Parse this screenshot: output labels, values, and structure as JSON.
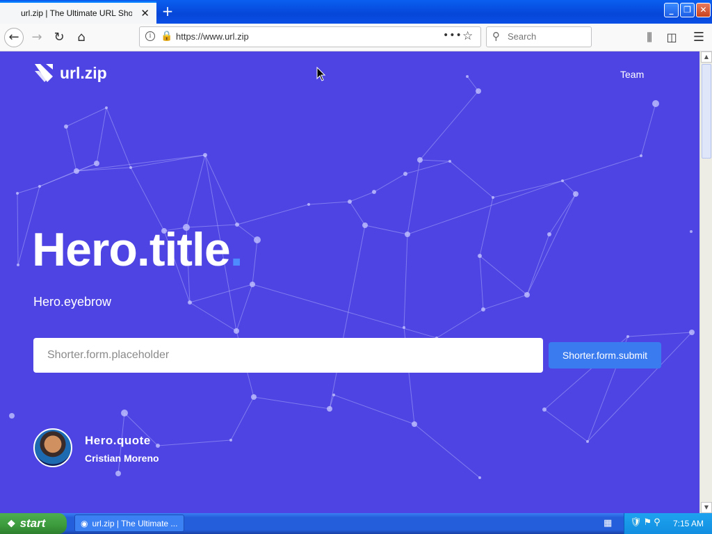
{
  "browser": {
    "tab_title": "url.zip | The Ultimate URL Shorten",
    "new_tab_icon": "+",
    "url": "https://www.url.zip",
    "search_placeholder": "Search"
  },
  "site": {
    "brand": "url.zip",
    "nav": {
      "team": "Team"
    },
    "hero": {
      "title": "Hero.title",
      "title_dot": ".",
      "eyebrow": "Hero.eyebrow",
      "form_placeholder": "Shorter.form.placeholder",
      "submit_label": "Shorter.form.submit",
      "quote": "Hero.quote",
      "author": "Cristian Moreno"
    },
    "colors": {
      "background": "#4e44e3",
      "accent": "#3a7bf0",
      "dot": "#4e8bff"
    }
  },
  "taskbar": {
    "start_label": "start",
    "task_label": "url.zip | The Ultimate ...",
    "clock": "7:15 AM"
  }
}
